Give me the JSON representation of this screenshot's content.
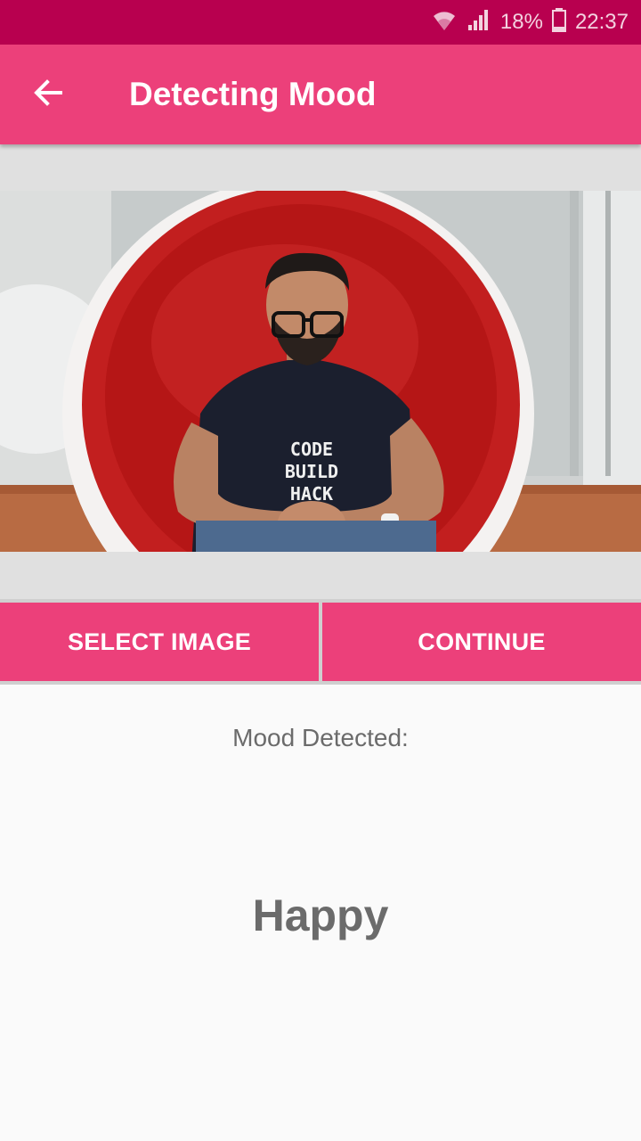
{
  "status_bar": {
    "battery_percent": "18%",
    "time": "22:37",
    "icons": [
      "wifi-icon",
      "signal-icon",
      "battery-icon"
    ]
  },
  "toolbar": {
    "title": "Detecting Mood",
    "back_icon": "arrow-back-icon"
  },
  "buttons": {
    "select_image": "SELECT IMAGE",
    "continue": "CONTINUE"
  },
  "result": {
    "label": "Mood Detected:",
    "mood": "Happy"
  },
  "colors": {
    "status_bar": "#b8004f",
    "primary": "#ec407a",
    "text_secondary": "#6b6b6b"
  }
}
